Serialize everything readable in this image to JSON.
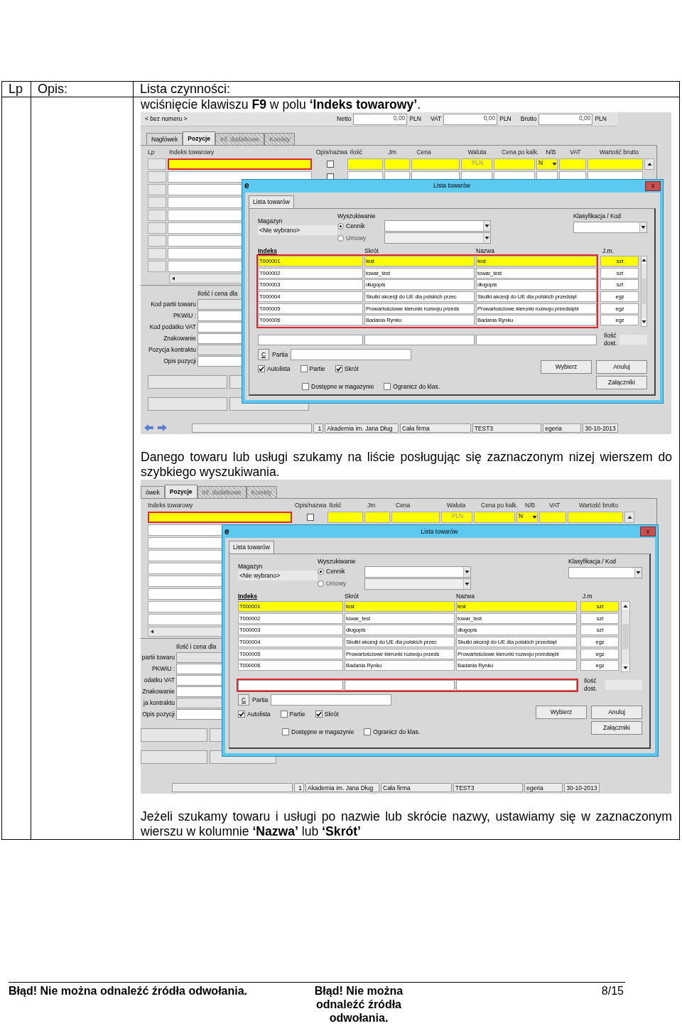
{
  "table": {
    "columns": [
      "Lp",
      "Opis:",
      "Lista czynności:"
    ]
  },
  "content": [
    {
      "kind": "paragraph",
      "text": "wciśnięcie klawiszu **F9** w polu **‘Indeks towarowy’**."
    },
    {
      "kind": "screenshot",
      "header": {
        "number": "< bez numeru >",
        "totals": [
          {
            "label": "Netto",
            "value": "0,00",
            "currency": "PLN"
          },
          {
            "label": "VAT",
            "value": "0,00",
            "currency": "PLN"
          },
          {
            "label": "Brutto",
            "value": "0,00",
            "currency": "PLN"
          }
        ]
      },
      "tabs": [
        {
          "label": "Nagłówek",
          "selected": false,
          "disabled": false
        },
        {
          "label": "Pozycje",
          "selected": true,
          "disabled": false
        },
        {
          "label": "Inf. dodatkowe",
          "selected": false,
          "disabled": true
        },
        {
          "label": "Korekty",
          "selected": false,
          "disabled": true
        }
      ],
      "grid": {
        "index_highlighted": true,
        "rows": [
          {
            "checked": false
          },
          {
            "checked": false
          }
        ],
        "columns": [
          {
            "label": "Lp",
            "kind": "lp"
          },
          {
            "label": "Indeks towarowy",
            "kind": "index"
          },
          {
            "label": "Opis/nazwa",
            "kind": "flag"
          },
          {
            "label": "Ilość",
            "kind": "qty"
          },
          {
            "label": "Jm",
            "kind": "unit"
          },
          {
            "label": "Cena",
            "kind": "price"
          },
          {
            "label": "Waluta",
            "kind": "currency",
            "value": "PLN"
          },
          {
            "label": "Cena po kalk.",
            "kind": "calc"
          },
          {
            "label": "N/B",
            "kind": "nb",
            "value": "N"
          },
          {
            "label": "VAT",
            "kind": "vat"
          },
          {
            "label": "Wartość brutto",
            "kind": "gross"
          }
        ]
      },
      "form": {
        "caption": "Ilość i cena dla",
        "fields": [
          {
            "label": "Kod partii towaru",
            "disabled": true
          },
          {
            "label": "PKWiU :",
            "disabled": false
          },
          {
            "label": "Kod podatku VAT",
            "disabled": false
          },
          {
            "label": "Znakowanie",
            "disabled": false
          },
          {
            "label": "Pozycja kontraktu",
            "disabled": true
          },
          {
            "label": "Opis pozycji",
            "disabled": false
          }
        ]
      },
      "status": {
        "arrows": true,
        "values": [
          "1",
          "Akademia im. Jana Dług",
          "Cała firma",
          "TEST3",
          "egeria",
          "30-10-2013"
        ]
      },
      "dialog": {
        "logo": "e",
        "title": "Lista towarów",
        "close": "x",
        "tabs": [
          {
            "label": "Lista towarów",
            "selected": true
          }
        ],
        "magazyn": {
          "label": "Magazyn",
          "value": "<Nie wybrano>"
        },
        "search": {
          "label": "Wyszukiwanie",
          "options": [
            {
              "label": "Cennik",
              "selected": true
            },
            {
              "label": "Umowy",
              "selected": false
            }
          ]
        },
        "classification": {
          "label": "Klasyfikacja / Kod"
        },
        "list": {
          "highlighted": true,
          "columns": [
            "Indeks",
            "Skrót",
            "Nazwa",
            "J.m."
          ],
          "rows": [
            {
              "selected": true,
              "cells": [
                "T000001",
                "test",
                "test",
                "szt"
              ]
            },
            {
              "selected": false,
              "cells": [
                "T000002",
                "towar_test",
                "towar_test",
                "szt"
              ]
            },
            {
              "selected": false,
              "cells": [
                "T000003",
                "długopis",
                "długopis",
                "szt"
              ]
            },
            {
              "selected": false,
              "cells": [
                "T000004",
                "Skutki akcesji do UE dla polskich przec",
                "Skutki akcesji do UE dla polskich przedsięt",
                "egz"
              ]
            },
            {
              "selected": false,
              "cells": [
                "T000005",
                "Prowartościowe kierunki rozwoju przeds",
                "Prowartościowe kierunki rozwoju przedsiębi",
                "egz"
              ]
            },
            {
              "selected": false,
              "cells": [
                "T000006",
                "Badania Rynku",
                "Badania Rynku",
                "egz"
              ]
            }
          ]
        },
        "filter": {
          "highlighted": false,
          "stock_label": "Ilość dost."
        },
        "c_button": "C",
        "partia_label": "Partia",
        "check_rows": [
          {
            "items": [
              {
                "label": "Autolista",
                "checked": true
              },
              {
                "label": "Partie",
                "checked": false
              },
              {
                "label": "Skrót",
                "checked": true
              }
            ]
          },
          {
            "items": [
              {
                "label": "Dostępne w magazynie",
                "checked": false
              },
              {
                "label": "Ogranicz do klas.",
                "checked": false
              }
            ]
          }
        ],
        "buttons": [
          {
            "label": "Wybierz"
          },
          {
            "label": "Anuluj"
          },
          {
            "label": "Załączniki"
          }
        ]
      }
    },
    {
      "kind": "paragraph",
      "text": "Danego towaru lub usługi szukamy na liście posługując się zaznaczonym nizej wierszem do szybkiego wyszukiwania."
    },
    {
      "kind": "screenshot",
      "tabs": [
        {
          "label": "ówek",
          "selected": false,
          "disabled": false
        },
        {
          "label": "Pozycje",
          "selected": true,
          "disabled": false
        },
        {
          "label": "Inf. dodatkowe",
          "selected": false,
          "disabled": true
        },
        {
          "label": "Korekty",
          "selected": false,
          "disabled": true
        }
      ],
      "grid": {
        "index_highlighted": true,
        "rows": [
          {
            "checked": false
          }
        ],
        "columns": [
          {
            "label": "Indeks towarowy",
            "kind": "index"
          },
          {
            "label": "Opis/nazwa",
            "kind": "flag"
          },
          {
            "label": "Ilość",
            "kind": "qty"
          },
          {
            "label": "Jm",
            "kind": "unit"
          },
          {
            "label": "Cena",
            "kind": "price"
          },
          {
            "label": "Waluta",
            "kind": "currency",
            "value": "PLN"
          },
          {
            "label": "Cena po kalk.",
            "kind": "calc"
          },
          {
            "label": "N/B",
            "kind": "nb",
            "value": "N"
          },
          {
            "label": "VAT",
            "kind": "vat"
          },
          {
            "label": "Wartość brutto",
            "kind": "gross"
          }
        ]
      },
      "form": {
        "caption": "Ilość i cena dla",
        "fields": [
          {
            "label": "partii towaru",
            "disabled": true
          },
          {
            "label": "PKWiU :",
            "disabled": false
          },
          {
            "label": "odatku VAT",
            "disabled": false
          },
          {
            "label": "Znakowanie",
            "disabled": false
          },
          {
            "label": "ja kontraktu",
            "disabled": true
          },
          {
            "label": "Opis pozycji",
            "disabled": false
          }
        ]
      },
      "status": {
        "arrows": false,
        "values": [
          "1",
          "Akademia im. Jana Dług",
          "Cała firma",
          "TEST3",
          "egeria",
          "30-10-2013"
        ]
      },
      "dialog": {
        "logo": "e",
        "title": "Lista towarów",
        "close": "x",
        "tabs": [
          {
            "label": "Lista towarów",
            "selected": true
          }
        ],
        "magazyn": {
          "label": "Magazyn",
          "value": "<Nie wybrano>"
        },
        "search": {
          "label": "Wyszukiwanie",
          "options": [
            {
              "label": "Cennik",
              "selected": true
            },
            {
              "label": "Umowy",
              "selected": false
            }
          ]
        },
        "classification": {
          "label": "Klasyfikacja / Kod"
        },
        "list": {
          "highlighted": false,
          "columns": [
            "Indeks",
            "Skrót",
            "Nazwa",
            "J.m"
          ],
          "rows": [
            {
              "selected": true,
              "cells": [
                "T000001",
                "test",
                "test",
                "szt"
              ]
            },
            {
              "selected": false,
              "cells": [
                "T000002",
                "towar_test",
                "towar_test",
                "szt"
              ]
            },
            {
              "selected": false,
              "cells": [
                "T000003",
                "długopis",
                "długopis",
                "szt"
              ]
            },
            {
              "selected": false,
              "cells": [
                "T000004",
                "Skutki akcesji do UE dla polskich przec",
                "Skutki akcesji do UE dla polskich przedsięt",
                "egz"
              ]
            },
            {
              "selected": false,
              "cells": [
                "T000005",
                "Prowartościowe kierunki rozwoju przeds",
                "Prowartościowe kierunki rozwoju przedsiębi",
                "egz"
              ]
            },
            {
              "selected": false,
              "cells": [
                "T000006",
                "Badania Rynku",
                "Badania Rynku",
                "egz"
              ]
            }
          ]
        },
        "filter": {
          "highlighted": true,
          "stock_label": "Ilość dost."
        },
        "c_button": "C",
        "partia_label": "Partia",
        "check_rows": [
          {
            "items": [
              {
                "label": "Autolista",
                "checked": true
              },
              {
                "label": "Partie",
                "checked": false
              },
              {
                "label": "Skrót",
                "checked": true
              }
            ]
          },
          {
            "items": [
              {
                "label": "Dostępne w magazynie",
                "checked": false
              },
              {
                "label": "Ogranicz do klas.",
                "checked": false
              }
            ]
          }
        ],
        "buttons": [
          {
            "label": "Wybierz"
          },
          {
            "label": "Anuluj"
          },
          {
            "label": "Załączniki"
          }
        ]
      }
    },
    {
      "kind": "paragraph",
      "text": "Jeżeli szukamy towaru i usługi po nazwie lub skrócie nazwy, ustawiamy się w zaznaczonym wierszu w kolumnie **‘Nazwa’** lub **‘Skrót’**"
    }
  ],
  "footer": {
    "left": "Błąd! Nie można odnaleźć źródła odwołania.",
    "center": "Błąd! Nie można odnaleźć źródła odwołania.",
    "page": "8/15"
  }
}
